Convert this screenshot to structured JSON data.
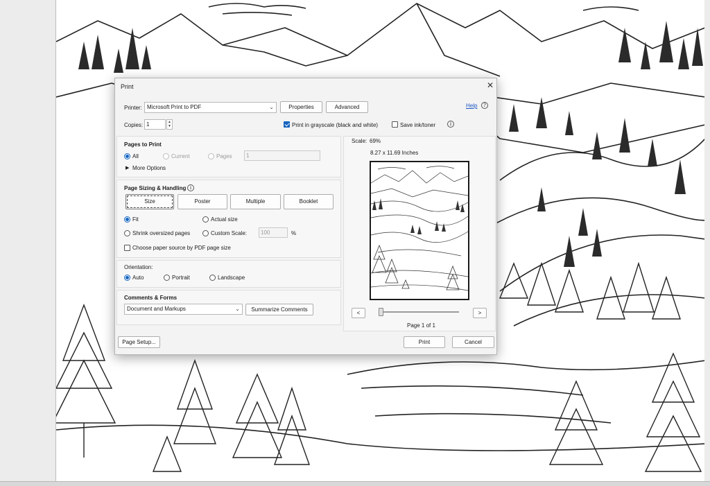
{
  "dialog": {
    "title": "Print",
    "close_icon": "close-icon",
    "printer": {
      "label": "Printer:",
      "value": "Microsoft Print to PDF"
    },
    "properties_label": "Properties",
    "advanced_label": "Advanced",
    "help_label": "Help",
    "copies": {
      "label": "Copies:",
      "value": "1"
    },
    "grayscale": {
      "label": "Print in grayscale (black and white)",
      "checked": true
    },
    "save_ink": {
      "label": "Save ink/toner",
      "checked": false
    },
    "pages_to_print": {
      "header": "Pages to Print",
      "all": "All",
      "current": "Current",
      "pages": "Pages",
      "pages_value": "1",
      "more_options": "More Options"
    },
    "sizing": {
      "header": "Page Sizing & Handling",
      "tabs": [
        "Size",
        "Poster",
        "Multiple",
        "Booklet"
      ],
      "fit": "Fit",
      "actual_size": "Actual size",
      "shrink": "Shrink oversized pages",
      "custom_scale": "Custom Scale:",
      "custom_scale_value": "100",
      "percent": "%",
      "paper_source": "Choose paper source by PDF page size"
    },
    "orientation": {
      "header": "Orientation:",
      "auto": "Auto",
      "portrait": "Portrait",
      "landscape": "Landscape"
    },
    "comments": {
      "header": "Comments & Forms",
      "value": "Document and Markups",
      "summarize_label": "Summarize Comments"
    },
    "preview": {
      "scale_label": "Scale:",
      "scale_value": "69%",
      "paper_size": "8.27 x 11.69 Inches",
      "prev_label": "<",
      "next_label": ">",
      "page_indicator": "Page 1 of 1"
    },
    "page_setup_label": "Page Setup...",
    "print_label": "Print",
    "cancel_label": "Cancel"
  }
}
